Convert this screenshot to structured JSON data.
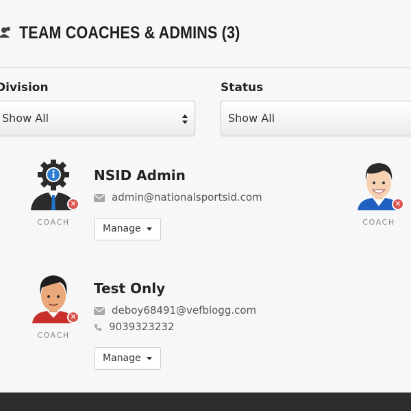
{
  "header": {
    "title": "TEAM COACHES & ADMINS (3)",
    "icon": "users-icon"
  },
  "filters": {
    "division": {
      "label": "Division",
      "selected": "Show All"
    },
    "status": {
      "label": "Status",
      "selected": "Show All"
    }
  },
  "members": [
    {
      "name": "NSID Admin",
      "role": "COACH",
      "email": "admin@nationalsportsid.com",
      "phone": "",
      "avatar": "admin-gear-avatar-icon",
      "manage_label": "Manage"
    },
    {
      "name": "Test Only",
      "role": "COACH",
      "email": "deboy68491@vefblogg.com",
      "phone": "9039323232",
      "avatar": "coach-avatar-icon",
      "manage_label": "Manage"
    },
    {
      "name": "",
      "role": "COACH",
      "avatar": "coach-avatar-icon"
    }
  ],
  "colors": {
    "remove_badge": "#d9534f",
    "footer": "#2d2d2d",
    "page_bg": "#f7f7f7"
  }
}
